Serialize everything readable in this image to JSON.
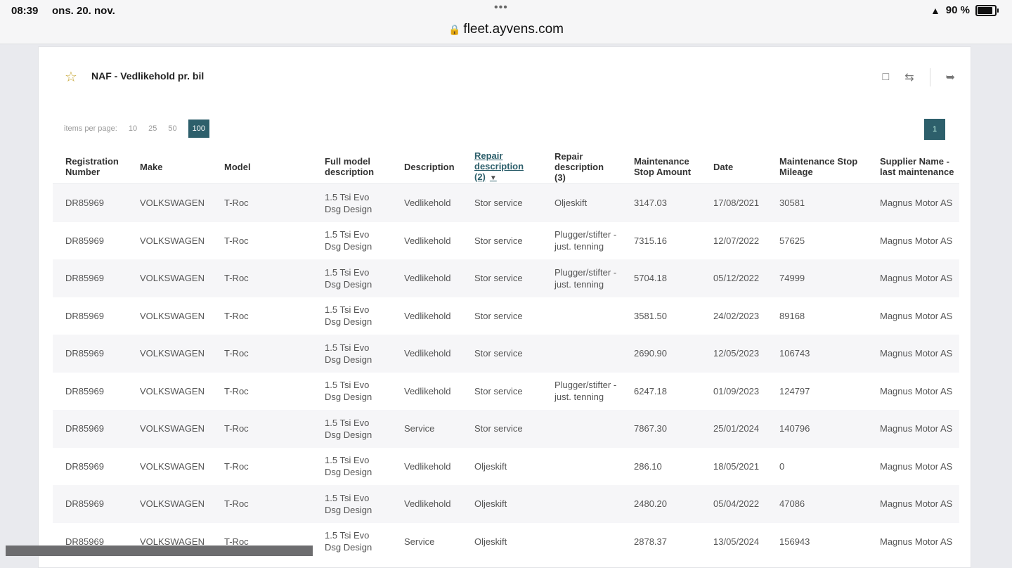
{
  "status_bar": {
    "time": "08:39",
    "date": "ons. 20. nov.",
    "dots": "•••",
    "url": "fleet.ayvens.com",
    "battery": "90 %"
  },
  "panel": {
    "title": "NAF - Vedlikehold pr. bil",
    "items_per_page_label": "items per page:",
    "page_sizes": [
      "10",
      "25",
      "50",
      "100"
    ],
    "current_page": "1"
  },
  "table": {
    "columns": [
      "Registration Number",
      "Make",
      "Model",
      "Full model description",
      "Description",
      "Repair description (2)",
      "Repair description (3)",
      "Maintenance Stop Amount",
      "Date",
      "Maintenance Stop Mileage",
      "Supplier Name - last maintenance"
    ],
    "rows": [
      [
        "DR85969",
        "VOLKSWAGEN",
        "T-Roc",
        "1.5 Tsi Evo Dsg Design",
        "Vedlikehold",
        "Stor service",
        "Oljeskift",
        "3147.03",
        "17/08/2021",
        "30581",
        "Magnus Motor AS"
      ],
      [
        "DR85969",
        "VOLKSWAGEN",
        "T-Roc",
        "1.5 Tsi Evo Dsg Design",
        "Vedlikehold",
        "Stor service",
        "Plugger/stifter - just. tenning",
        "7315.16",
        "12/07/2022",
        "57625",
        "Magnus Motor AS"
      ],
      [
        "DR85969",
        "VOLKSWAGEN",
        "T-Roc",
        "1.5 Tsi Evo Dsg Design",
        "Vedlikehold",
        "Stor service",
        "Plugger/stifter - just. tenning",
        "5704.18",
        "05/12/2022",
        "74999",
        "Magnus Motor AS"
      ],
      [
        "DR85969",
        "VOLKSWAGEN",
        "T-Roc",
        "1.5 Tsi Evo Dsg Design",
        "Vedlikehold",
        "Stor service",
        "",
        "3581.50",
        "24/02/2023",
        "89168",
        "Magnus Motor AS"
      ],
      [
        "DR85969",
        "VOLKSWAGEN",
        "T-Roc",
        "1.5 Tsi Evo Dsg Design",
        "Vedlikehold",
        "Stor service",
        "",
        "2690.90",
        "12/05/2023",
        "106743",
        "Magnus Motor AS"
      ],
      [
        "DR85969",
        "VOLKSWAGEN",
        "T-Roc",
        "1.5 Tsi Evo Dsg Design",
        "Vedlikehold",
        "Stor service",
        "Plugger/stifter - just. tenning",
        "6247.18",
        "01/09/2023",
        "124797",
        "Magnus Motor AS"
      ],
      [
        "DR85969",
        "VOLKSWAGEN",
        "T-Roc",
        "1.5 Tsi Evo Dsg Design",
        "Service",
        "Stor service",
        "",
        "7867.30",
        "25/01/2024",
        "140796",
        "Magnus Motor AS"
      ],
      [
        "DR85969",
        "VOLKSWAGEN",
        "T-Roc",
        "1.5 Tsi Evo Dsg Design",
        "Vedlikehold",
        "Oljeskift",
        "",
        "286.10",
        "18/05/2021",
        "0",
        "Magnus Motor AS"
      ],
      [
        "DR85969",
        "VOLKSWAGEN",
        "T-Roc",
        "1.5 Tsi Evo Dsg Design",
        "Vedlikehold",
        "Oljeskift",
        "",
        "2480.20",
        "05/04/2022",
        "47086",
        "Magnus Motor AS"
      ],
      [
        "DR85969",
        "VOLKSWAGEN",
        "T-Roc",
        "1.5 Tsi Evo Dsg Design",
        "Service",
        "Oljeskift",
        "",
        "2878.37",
        "13/05/2024",
        "156943",
        "Magnus Motor AS"
      ]
    ]
  }
}
